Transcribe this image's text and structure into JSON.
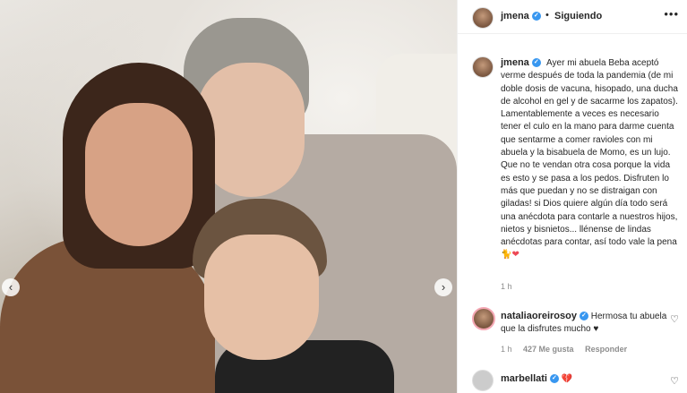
{
  "post": {
    "author": "jmena",
    "follow_status": "Siguiendo",
    "more_icon": "•••",
    "caption": "Ayer mi abuela Beba aceptó verme después de toda la pandemia (de mi doble dosis de vacuna, hisopado, una ducha de alcohol en gel y de sacarme los zapatos). Lamentablemente a veces es necesario tener el culo en la mano para darme cuenta que sentarme a comer ravioles con mi abuela y la bisabuela de Momo, es un lujo. Que no te vendan otra cosa porque la vida es esto y se pasa a los pedos. Disfruten lo más que puedan y no se distraigan con giladas! si Dios quiere algún día todo será una anécdota para contarle a nuestros hijos, nietos y bisnietos... llénense de lindas anécdotas para contar, así todo vale la pena",
    "caption_emoji": "🐈❤",
    "time": "1 h",
    "nav_prev": "‹",
    "nav_next": "›"
  },
  "comments": [
    {
      "user": "nataliaoreirosoy",
      "text": "Hermosa tu abuela que la disfrutes mucho",
      "emoji": "♥",
      "time": "1 h",
      "likes": "427 Me gusta",
      "reply": "Responder",
      "heart_icon": "♡"
    },
    {
      "user": "marbellati",
      "emoji": "💔",
      "heart_icon": "♡"
    }
  ],
  "colors": {
    "verified": "#3897f0",
    "meta": "#8e8e8e"
  }
}
